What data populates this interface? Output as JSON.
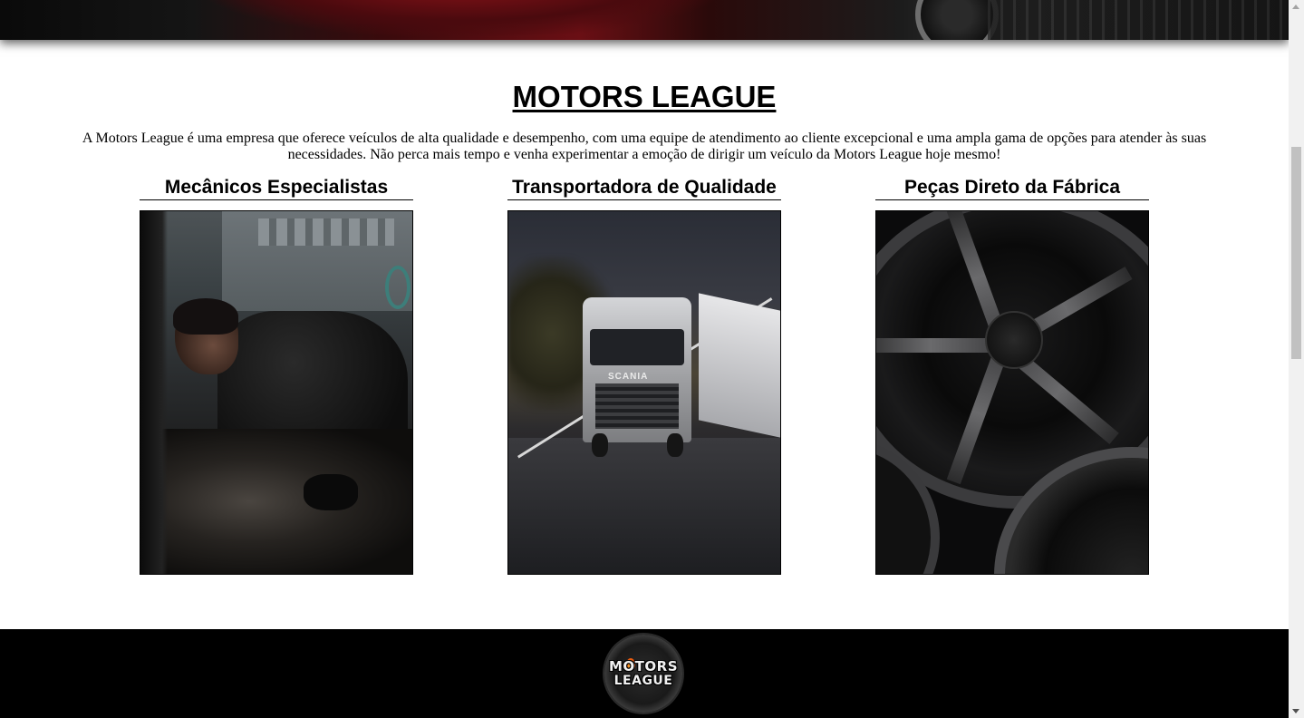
{
  "hero": {
    "description_icon": "car-photo"
  },
  "main": {
    "title": "MOTORS LEAGUE",
    "intro": "A Motors League é uma empresa que oferece veículos de alta qualidade e desempenho, com uma equipe de atendimento ao cliente excepcional e uma ampla gama de opções para atender às suas necessidades. Não perca mais tempo e venha experimentar a emoção de dirigir um veículo da Motors League hoje mesmo!",
    "cards": [
      {
        "title": "Mecânicos Especialistas",
        "image_icon": "mechanic-photo"
      },
      {
        "title": "Transportadora de Qualidade",
        "image_icon": "truck-photo",
        "image_text": "SCANIA"
      },
      {
        "title": "Peças Direto da Fábrica",
        "image_icon": "wheel-rims-photo"
      }
    ]
  },
  "footer": {
    "logo_line1": "MOTORS",
    "logo_line2": "LEAGUE",
    "logo_icon": "motors-league-logo"
  },
  "colors": {
    "background": "#ffffff",
    "footer": "#000000",
    "text": "#000000",
    "flame": "#f06a10"
  }
}
